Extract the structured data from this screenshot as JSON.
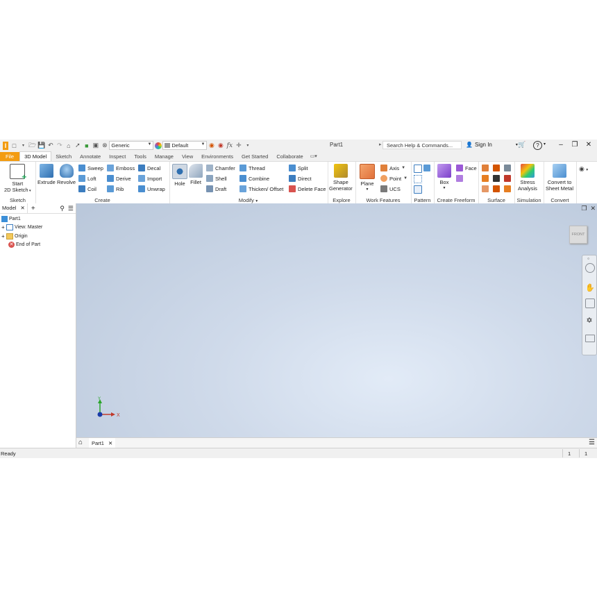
{
  "titlebar": {
    "doc_title": "Part1",
    "material": "Generic",
    "appearance": "Default",
    "fx": "fx",
    "search_placeholder": "Search Help & Commands...",
    "sign_in": "Sign In",
    "help": "?"
  },
  "tabs": [
    {
      "label": "File"
    },
    {
      "label": "3D Model"
    },
    {
      "label": "Sketch"
    },
    {
      "label": "Annotate"
    },
    {
      "label": "Inspect"
    },
    {
      "label": "Tools"
    },
    {
      "label": "Manage"
    },
    {
      "label": "View"
    },
    {
      "label": "Environments"
    },
    {
      "label": "Get Started"
    },
    {
      "label": "Collaborate"
    }
  ],
  "ribbon": {
    "sketch": {
      "title": "Sketch",
      "start_line1": "Start",
      "start_line2": "2D Sketch"
    },
    "create": {
      "title": "Create",
      "extrude": "Extrude",
      "revolve": "Revolve",
      "sweep": "Sweep",
      "loft": "Loft",
      "coil": "Coil",
      "emboss": "Emboss",
      "derive": "Derive",
      "rib": "Rib",
      "decal": "Decal",
      "import": "Import",
      "unwrap": "Unwrap"
    },
    "modify": {
      "title": "Modify",
      "hole": "Hole",
      "fillet": "Fillet",
      "chamfer": "Chamfer",
      "shell": "Shell",
      "draft": "Draft",
      "thread": "Thread",
      "combine": "Combine",
      "thicken": "Thicken/ Offset",
      "split": "Split",
      "direct": "Direct",
      "delete_face": "Delete Face"
    },
    "explore": {
      "title": "Explore",
      "shape_line1": "Shape",
      "shape_line2": "Generator"
    },
    "work_features": {
      "title": "Work Features",
      "plane": "Plane",
      "axis": "Axis",
      "point": "Point",
      "ucs": "UCS"
    },
    "pattern": {
      "title": "Pattern"
    },
    "freeform": {
      "title": "Create Freeform",
      "box": "Box",
      "face": "Face"
    },
    "surface": {
      "title": "Surface"
    },
    "simulation": {
      "title": "Simulation",
      "stress_line1": "Stress",
      "stress_line2": "Analysis"
    },
    "convert": {
      "title": "Convert",
      "line1": "Convert to",
      "line2": "Sheet Metal"
    }
  },
  "browser": {
    "tab_label": "Model",
    "items": [
      {
        "label": "Part1"
      },
      {
        "label": "View: Master"
      },
      {
        "label": "Origin"
      },
      {
        "label": "End of Part"
      }
    ]
  },
  "viewport": {
    "viewcube_label": "FRONT",
    "triad_x": "X",
    "triad_y": "Y"
  },
  "doc_tab": {
    "label": "Part1"
  },
  "status": {
    "text": "Ready",
    "count1": "1",
    "count2": "1"
  },
  "colors": {
    "accent_orange": "#f39c12",
    "viewport_center": "#e2ebf7",
    "viewport_edge": "#b9c7da"
  }
}
